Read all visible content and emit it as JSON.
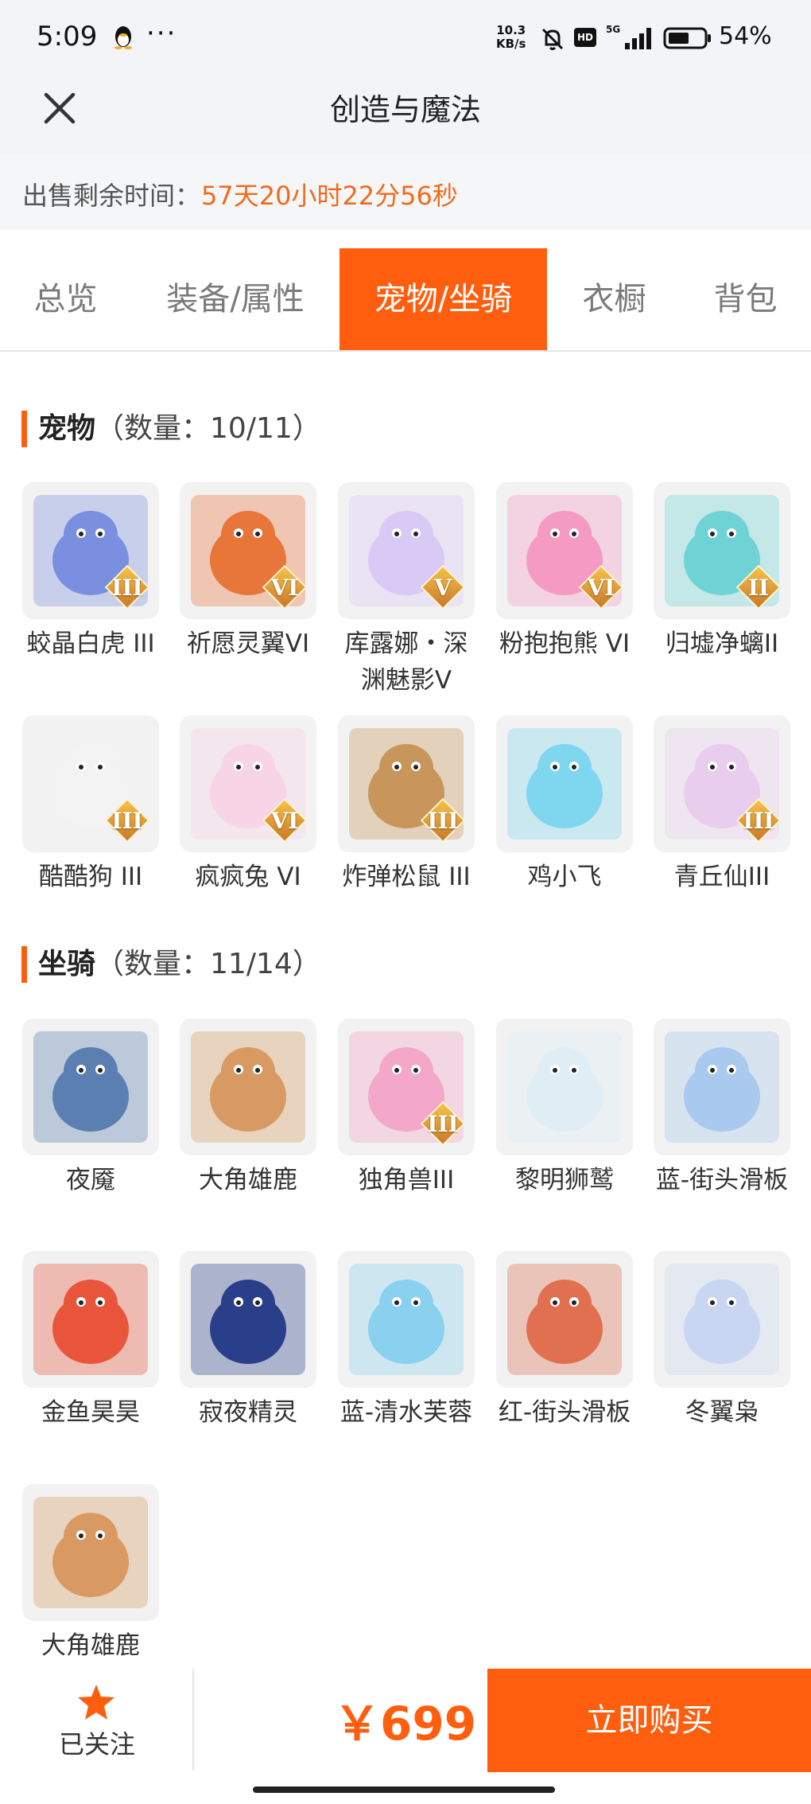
{
  "status_bar": {
    "time": "5:09",
    "dots": "···",
    "speed_top": "10.3",
    "speed_bottom": "KB/s",
    "hd": "HD",
    "network": "5G",
    "battery": "54%"
  },
  "header": {
    "title": "创造与魔法"
  },
  "timer": {
    "label": "出售剩余时间：",
    "value": "57天20小时22分56秒"
  },
  "tabs": [
    {
      "label": "总览"
    },
    {
      "label": "装备/属性"
    },
    {
      "label": "宠物/坐骑"
    },
    {
      "label": "衣橱"
    },
    {
      "label": "背包"
    }
  ],
  "pets": {
    "title": "宠物",
    "count": "（数量：10/11）",
    "items": [
      {
        "name": "蛟晶白虎 III",
        "badge": "III",
        "icon": "tiger-icon",
        "bg": "#7b8fe0"
      },
      {
        "name": "祈愿灵翼VI",
        "badge": "VI",
        "icon": "bird-icon",
        "bg": "#e8753a"
      },
      {
        "name": "库露娜・深渊魅影V",
        "badge": "V",
        "icon": "fairy-icon",
        "bg": "#d9c9f5"
      },
      {
        "name": "粉抱抱熊 VI",
        "badge": "VI",
        "icon": "bear-icon",
        "bg": "#f59ac2"
      },
      {
        "name": "归墟净螭II",
        "badge": "II",
        "icon": "dragon-icon",
        "bg": "#6fd3d6"
      },
      {
        "name": "酷酷狗 III",
        "badge": "III",
        "icon": "dog-icon",
        "bg": "#f3f3f3"
      },
      {
        "name": "疯疯兔 VI",
        "badge": "VI",
        "icon": "rabbit-icon",
        "bg": "#f7d4e6"
      },
      {
        "name": "炸弹松鼠 III",
        "badge": "III",
        "icon": "squirrel-icon",
        "bg": "#c8955a"
      },
      {
        "name": "鸡小飞",
        "badge": "",
        "icon": "chick-icon",
        "bg": "#7fd6ef"
      },
      {
        "name": "青丘仙III",
        "badge": "III",
        "icon": "fox-fairy-icon",
        "bg": "#e8cdee"
      }
    ]
  },
  "mounts": {
    "title": "坐骑",
    "count": "（数量：11/14）",
    "items": [
      {
        "name": "夜魇",
        "badge": "",
        "icon": "nightmare-horse-icon",
        "bg": "#5a7fb0"
      },
      {
        "name": "大角雄鹿",
        "badge": "",
        "icon": "stag-icon",
        "bg": "#d89a62"
      },
      {
        "name": "独角兽III",
        "badge": "III",
        "icon": "unicorn-icon",
        "bg": "#f3a7c9"
      },
      {
        "name": "黎明狮鹫",
        "badge": "",
        "icon": "griffin-icon",
        "bg": "#dfeef5"
      },
      {
        "name": "蓝-街头滑板",
        "badge": "",
        "icon": "skateboard-icon",
        "bg": "#a9c9ee"
      },
      {
        "name": "金鱼昊昊",
        "badge": "",
        "icon": "goldfish-icon",
        "bg": "#e8553b"
      },
      {
        "name": "寂夜精灵",
        "badge": "",
        "icon": "night-fox-icon",
        "bg": "#2a3f8a"
      },
      {
        "name": "蓝-清水芙蓉",
        "badge": "",
        "icon": "lotus-icon",
        "bg": "#8ad0ef"
      },
      {
        "name": "红-街头滑板",
        "badge": "",
        "icon": "skateboard-icon",
        "bg": "#e07050"
      },
      {
        "name": "冬翼枭",
        "badge": "",
        "icon": "owl-icon",
        "bg": "#c9d6f2"
      },
      {
        "name": "大角雄鹿",
        "badge": "",
        "icon": "stag-icon",
        "bg": "#d89a62"
      }
    ]
  },
  "bottom": {
    "follow_label": "已关注",
    "price": "￥699",
    "buy_label": "立即购买"
  }
}
